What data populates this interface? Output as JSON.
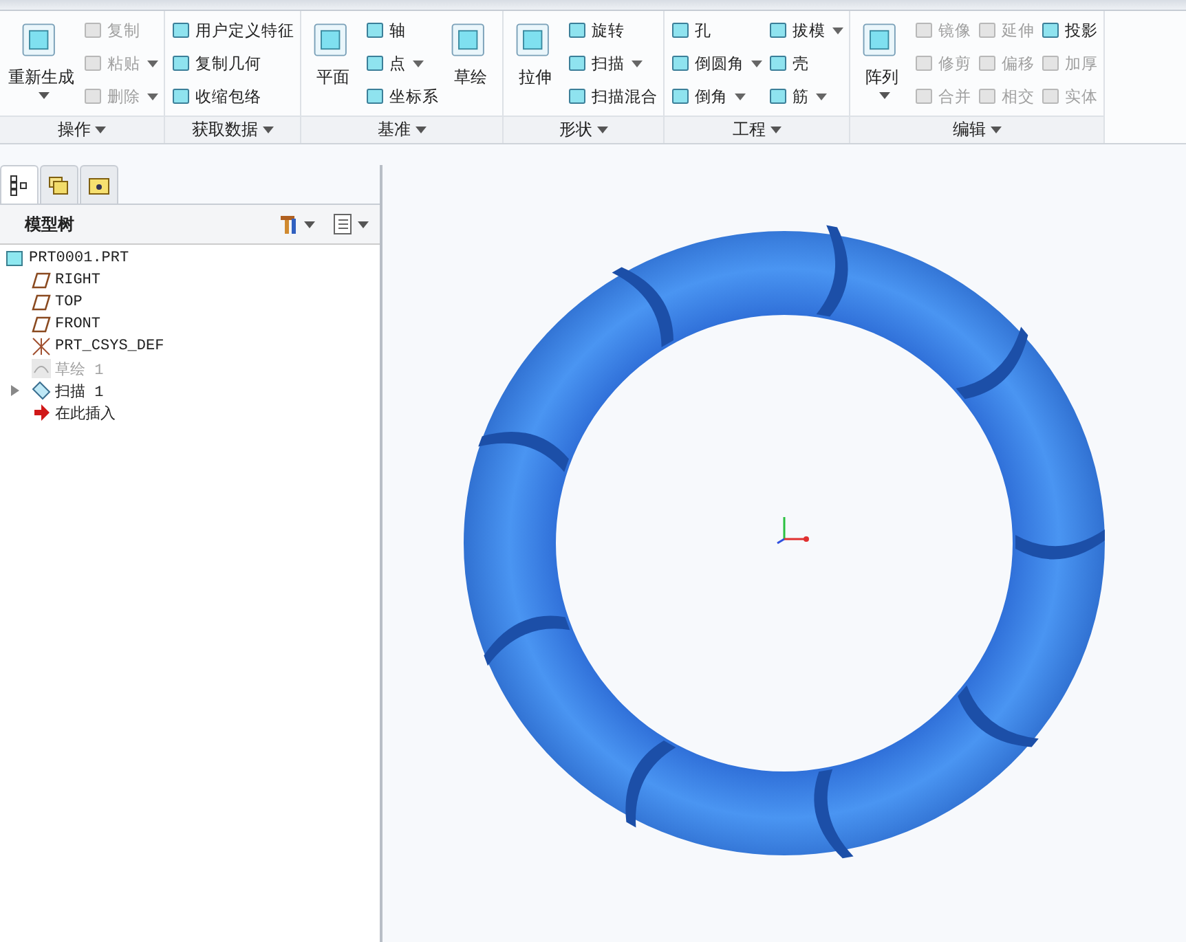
{
  "ribbon": {
    "groups": [
      {
        "label": "操作",
        "columns": [
          [
            {
              "kind": "large",
              "label": "重新生成",
              "disabled": false,
              "dropdown": true
            }
          ],
          [
            {
              "kind": "small",
              "label": "复制",
              "disabled": true,
              "dropdown": false
            },
            {
              "kind": "small",
              "label": "粘贴",
              "disabled": true,
              "dropdown": true
            },
            {
              "kind": "small",
              "label": "删除",
              "disabled": true,
              "dropdown": true
            }
          ]
        ]
      },
      {
        "label": "获取数据",
        "columns": [
          [
            {
              "kind": "small",
              "label": "用户定义特征",
              "disabled": false,
              "dropdown": false
            },
            {
              "kind": "small",
              "label": "复制几何",
              "disabled": false,
              "dropdown": false
            },
            {
              "kind": "small",
              "label": "收缩包络",
              "disabled": false,
              "dropdown": false
            }
          ]
        ]
      },
      {
        "label": "基准",
        "columns": [
          [
            {
              "kind": "large",
              "label": "平面",
              "disabled": false,
              "dropdown": false
            }
          ],
          [
            {
              "kind": "small",
              "label": "轴",
              "disabled": false,
              "dropdown": false
            },
            {
              "kind": "small",
              "label": "点",
              "disabled": false,
              "dropdown": true
            },
            {
              "kind": "small",
              "label": "坐标系",
              "disabled": false,
              "dropdown": false
            }
          ],
          [
            {
              "kind": "large",
              "label": "草绘",
              "disabled": false,
              "dropdown": false
            }
          ]
        ]
      },
      {
        "label": "形状",
        "columns": [
          [
            {
              "kind": "large",
              "label": "拉伸",
              "disabled": false,
              "dropdown": false
            }
          ],
          [
            {
              "kind": "small",
              "label": "旋转",
              "disabled": false,
              "dropdown": false
            },
            {
              "kind": "small",
              "label": "扫描",
              "disabled": false,
              "dropdown": true
            },
            {
              "kind": "small",
              "label": "扫描混合",
              "disabled": false,
              "dropdown": false
            }
          ]
        ]
      },
      {
        "label": "工程",
        "columns": [
          [
            {
              "kind": "small",
              "label": "孔",
              "disabled": false,
              "dropdown": false
            },
            {
              "kind": "small",
              "label": "倒圆角",
              "disabled": false,
              "dropdown": true
            },
            {
              "kind": "small",
              "label": "倒角",
              "disabled": false,
              "dropdown": true
            }
          ],
          [
            {
              "kind": "small",
              "label": "拔模",
              "disabled": false,
              "dropdown": true
            },
            {
              "kind": "small",
              "label": "壳",
              "disabled": false,
              "dropdown": false
            },
            {
              "kind": "small",
              "label": "筋",
              "disabled": false,
              "dropdown": true
            }
          ]
        ]
      },
      {
        "label": "编辑",
        "columns": [
          [
            {
              "kind": "large",
              "label": "阵列",
              "disabled": false,
              "dropdown": true
            }
          ],
          [
            {
              "kind": "small",
              "label": "镜像",
              "disabled": true,
              "dropdown": false
            },
            {
              "kind": "small",
              "label": "修剪",
              "disabled": true,
              "dropdown": false
            },
            {
              "kind": "small",
              "label": "合并",
              "disabled": true,
              "dropdown": false
            }
          ],
          [
            {
              "kind": "small",
              "label": "延伸",
              "disabled": true,
              "dropdown": false
            },
            {
              "kind": "small",
              "label": "偏移",
              "disabled": true,
              "dropdown": false
            },
            {
              "kind": "small",
              "label": "相交",
              "disabled": true,
              "dropdown": false
            }
          ],
          [
            {
              "kind": "small",
              "label": "投影",
              "disabled": false,
              "dropdown": false
            },
            {
              "kind": "small",
              "label": "加厚",
              "disabled": true,
              "dropdown": false
            },
            {
              "kind": "small",
              "label": "实体",
              "disabled": true,
              "dropdown": false
            }
          ]
        ]
      }
    ]
  },
  "panel": {
    "tabs": [
      {
        "selected": true
      },
      {
        "selected": false
      },
      {
        "selected": false
      }
    ],
    "title": "模型树",
    "tree": {
      "kind": "part",
      "label": "PRT0001.PRT",
      "disabled": false,
      "children": [
        {
          "kind": "plane",
          "label": "RIGHT",
          "disabled": false
        },
        {
          "kind": "plane",
          "label": "TOP",
          "disabled": false
        },
        {
          "kind": "plane",
          "label": "FRONT",
          "disabled": false
        },
        {
          "kind": "csys",
          "label": "PRT_CSYS_DEF",
          "disabled": false
        },
        {
          "kind": "sketch",
          "label": "草绘 1",
          "disabled": true
        },
        {
          "kind": "sweep",
          "label": "扫描 1",
          "disabled": false,
          "expanded": false
        },
        {
          "kind": "insert",
          "label": "在此插入",
          "disabled": false
        }
      ]
    }
  }
}
